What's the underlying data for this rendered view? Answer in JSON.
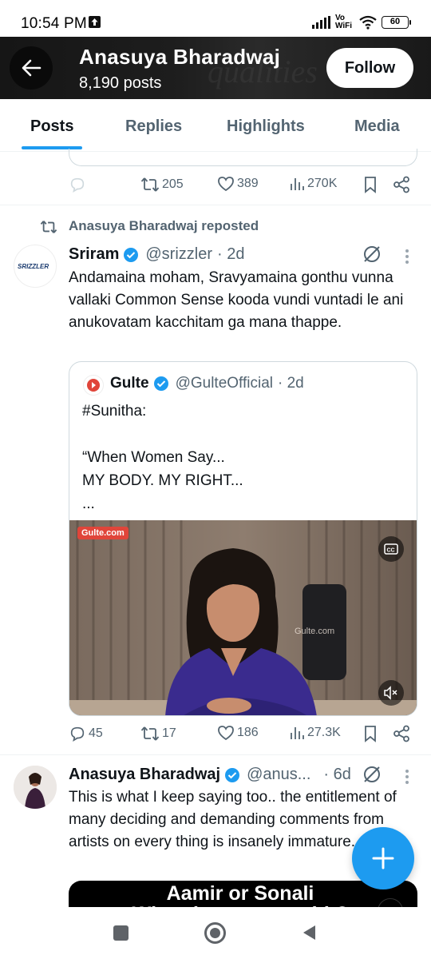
{
  "status_bar": {
    "time": "10:54 PM",
    "network": "Vo WiFi",
    "battery": "60"
  },
  "header": {
    "name": "Anasuya Bharadwaj",
    "posts": "8,190 posts",
    "follow_label": "Follow",
    "watermark": "qualities"
  },
  "tabs": [
    {
      "label": "Posts",
      "active": true
    },
    {
      "label": "Replies",
      "active": false
    },
    {
      "label": "Highlights",
      "active": false
    },
    {
      "label": "Media",
      "active": false
    }
  ],
  "tweet1_actions": {
    "reposts": "205",
    "likes": "389",
    "views": "270K"
  },
  "repost_label": "Anasuya Bharadwaj reposted",
  "tweet2": {
    "name": "Sriram",
    "handle": "@srizzler",
    "time": "· 2d",
    "avatar_text": "SRIZZLER",
    "text": "Andamaina moham, Sravyamaina gonthu vunna vallaki Common Sense kooda vundi vuntadi le ani anukovatam kacchitam ga mana thappe.",
    "quote": {
      "name": "Gulte",
      "handle": "@GulteOfficial",
      "time": "· 2d",
      "text": "#Sunitha:\n\n“When Women Say...\nMY BODY. MY RIGHT...\n...",
      "video_logo": "Gulte.com",
      "video_watermark": "Gulte.com"
    },
    "actions": {
      "replies": "45",
      "reposts": "17",
      "likes": "186",
      "views": "27.3K"
    }
  },
  "tweet3": {
    "name": "Anasuya Bharadwaj",
    "handle": "@anus...",
    "time": "· 6d",
    "text": "This is what I keep saying too.. the entitlement of many deciding and demanding comments from artists on every thing is insanely immature..",
    "video_title_line1": "Aamir or Sonali",
    "video_title_line2": "What do you say with?"
  },
  "colors": {
    "accent": "#1d9bf0",
    "muted": "#536471",
    "text": "#0f1419"
  }
}
